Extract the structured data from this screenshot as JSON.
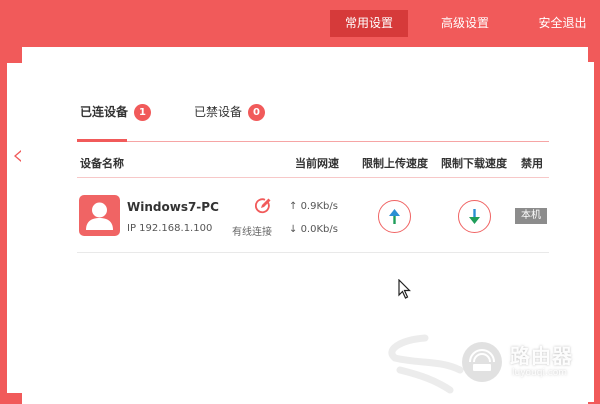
{
  "nav": {
    "common": "常用设置",
    "advanced": "高级设置",
    "logout": "安全退出"
  },
  "tabs": {
    "connected": {
      "label": "已连设备",
      "count": "1"
    },
    "blocked": {
      "label": "已禁设备",
      "count": "0"
    }
  },
  "table": {
    "headers": {
      "name": "设备名称",
      "speed": "当前网速",
      "up_limit": "限制上传速度",
      "down_limit": "限制下载速度",
      "ban": "禁用"
    },
    "rows": [
      {
        "name": "Windows7-PC",
        "ip": "IP 192.168.1.100",
        "conn_type": "有线连接",
        "up_rate": "0.9Kb/s",
        "down_rate": "0.0Kb/s",
        "ban_label": "本机"
      }
    ]
  },
  "watermark": {
    "title": "路由器",
    "url": "luyouqi.com"
  },
  "colors": {
    "accent": "#f15a5a",
    "accent_dark": "#d63a3a",
    "up_arrow": "#1f9e5a",
    "down_arrow": "#2a8fd4",
    "badge_gray": "#8c8c8c"
  },
  "icons": {
    "avatar": "user-icon",
    "edit": "edit-icon",
    "up_limit": "arrow-up-icon",
    "down_limit": "arrow-down-icon",
    "cursor": "mouse-cursor-icon",
    "watermark": "router-icon"
  }
}
